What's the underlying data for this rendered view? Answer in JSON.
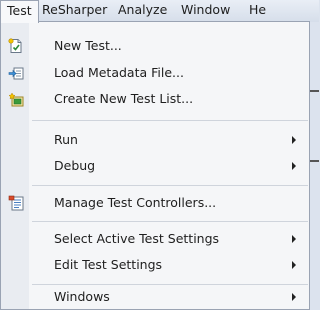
{
  "menubar": {
    "items": [
      {
        "label": "Test"
      },
      {
        "label": "ReSharper"
      },
      {
        "label": "Analyze"
      },
      {
        "label": "Window"
      },
      {
        "label": "He"
      }
    ]
  },
  "menu": {
    "new_test": {
      "label": "New Test...",
      "icon": "new-test-icon"
    },
    "load_metadata": {
      "label": "Load Metadata File...",
      "icon": "load-metadata-icon"
    },
    "create_test_list": {
      "label": "Create New Test List...",
      "icon": "create-test-list-icon"
    },
    "run": {
      "label": "Run"
    },
    "debug": {
      "label": "Debug"
    },
    "manage_controllers": {
      "label": "Manage Test Controllers...",
      "icon": "test-controllers-icon"
    },
    "select_settings": {
      "label": "Select Active Test Settings"
    },
    "edit_settings": {
      "label": "Edit Test Settings"
    },
    "windows": {
      "label": "Windows"
    }
  },
  "colors": {
    "menu_background": "#f5f6f8",
    "icon_gutter": "#e9ecf1",
    "menubar": "#dce3ee"
  }
}
